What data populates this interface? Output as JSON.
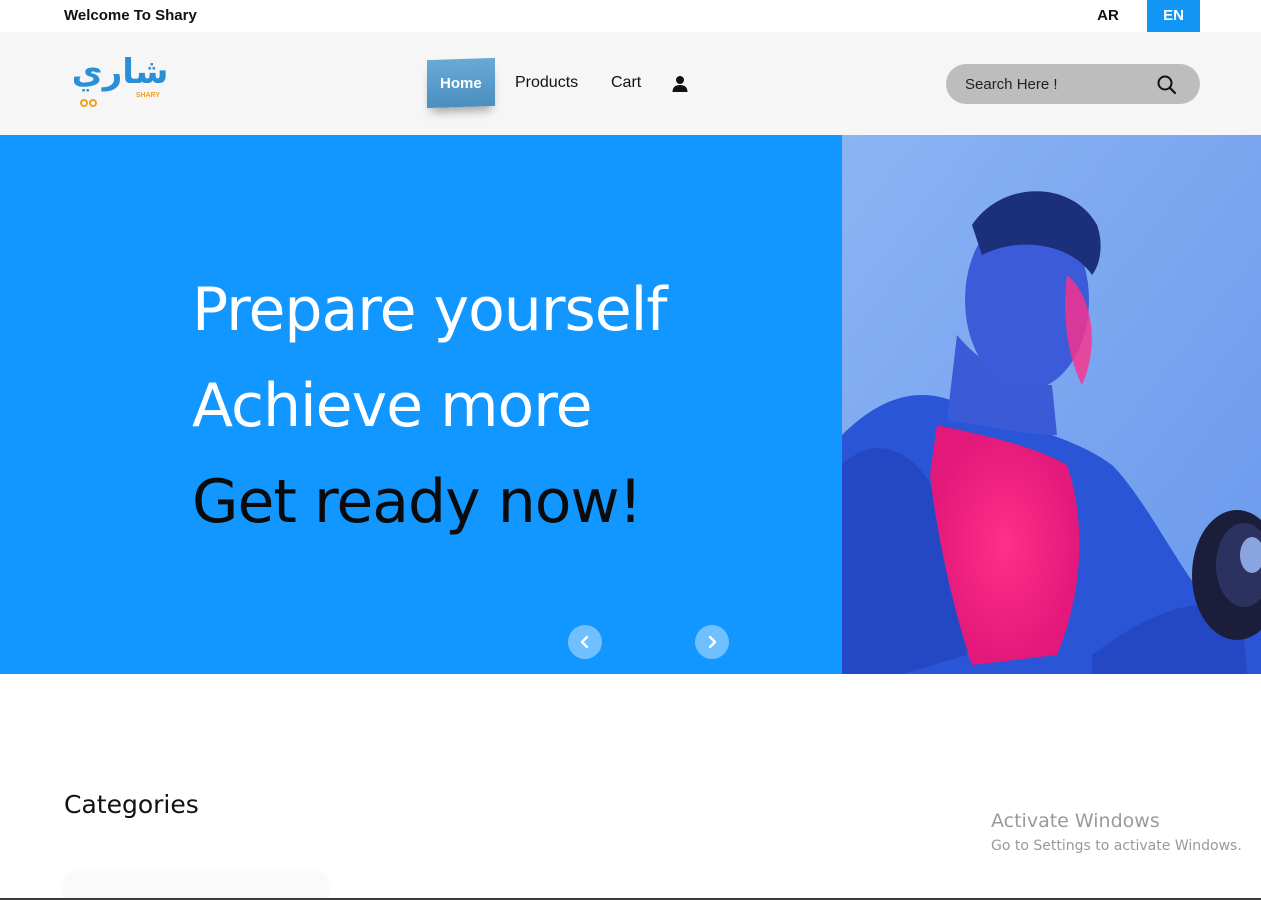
{
  "topbar": {
    "welcome": "Welcome To Shary",
    "lang_ar": "AR",
    "lang_en": "EN"
  },
  "navbar": {
    "logo_alt": "Shary logo",
    "logo_arabic": "شاري",
    "logo_latin": "SHARY",
    "home": "Home",
    "products": "Products",
    "cart": "Cart",
    "user_icon": "user-icon"
  },
  "search": {
    "placeholder": "Search Here !",
    "icon": "search-icon"
  },
  "hero": {
    "line1": "Prepare yourself",
    "line2": "Achieve more",
    "line3": "Get ready now!",
    "prev_icon": "chevron-left-icon",
    "next_icon": "chevron-right-icon",
    "image_alt": "Athlete lifting dumbbell under blue and pink lighting"
  },
  "categories": {
    "title": "Categories"
  },
  "watermark": {
    "line1": "Activate Windows",
    "line2": "Go to Settings to activate Windows."
  },
  "colors": {
    "accent": "#1296ff",
    "lang_active": "#1296f6",
    "nav_bg": "#f6f6f6",
    "search_bg": "#bdbdbd"
  }
}
